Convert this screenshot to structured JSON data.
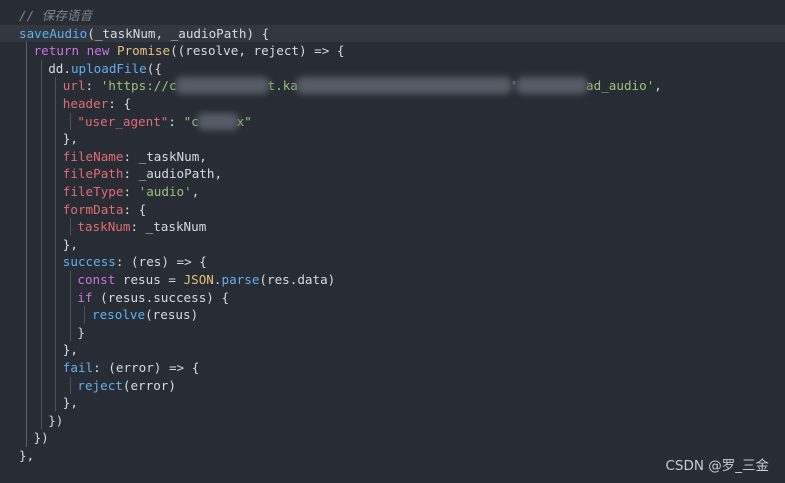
{
  "colors": {
    "background": "#282c34",
    "active_line": "#33373f",
    "comment": "#7f848e",
    "keyword": "#c678dd",
    "function": "#61afef",
    "class": "#e5c07b",
    "property": "#e06c75",
    "string": "#98c379",
    "text": "#d7dae0"
  },
  "editor": {
    "lines": [
      {
        "indent": 0,
        "active": false,
        "tokens": [
          {
            "t": "// 保存语音",
            "c": "comment"
          }
        ]
      },
      {
        "indent": 0,
        "active": true,
        "tokens": [
          {
            "t": "saveAudio",
            "c": "function"
          },
          {
            "t": "(_taskNum, _audioPath) {",
            "c": "text"
          }
        ]
      },
      {
        "indent": 1,
        "active": false,
        "tokens": [
          {
            "t": "return ",
            "c": "keyword"
          },
          {
            "t": "new ",
            "c": "keyword"
          },
          {
            "t": "Promise",
            "c": "class"
          },
          {
            "t": "((resolve, reject) => {",
            "c": "text"
          }
        ]
      },
      {
        "indent": 2,
        "active": false,
        "tokens": [
          {
            "t": "dd.",
            "c": "text"
          },
          {
            "t": "uploadFile",
            "c": "function"
          },
          {
            "t": "({",
            "c": "text"
          }
        ]
      },
      {
        "indent": 3,
        "active": false,
        "tokens": [
          {
            "t": "url",
            "c": "property"
          },
          {
            "t": ": ",
            "c": "text"
          },
          {
            "t": "'https://c",
            "c": "string"
          },
          {
            "t": "            ",
            "c": "text",
            "blur": true
          },
          {
            "t": "t.ka",
            "c": "string"
          },
          {
            "t": "                            ",
            "c": "text",
            "blur": true
          },
          {
            "t": "'",
            "c": "string"
          },
          {
            "t": "         ",
            "c": "text",
            "blur": true
          },
          {
            "t": "ad_audio'",
            "c": "string"
          },
          {
            "t": ",",
            "c": "text"
          }
        ]
      },
      {
        "indent": 3,
        "active": false,
        "tokens": [
          {
            "t": "header",
            "c": "property"
          },
          {
            "t": ": {",
            "c": "text"
          }
        ]
      },
      {
        "indent": 4,
        "active": false,
        "tokens": [
          {
            "t": "\"user_agent\"",
            "c": "property"
          },
          {
            "t": ": ",
            "c": "text"
          },
          {
            "t": "\"c",
            "c": "string"
          },
          {
            "t": "     ",
            "c": "text",
            "blur": true
          },
          {
            "t": "x\"",
            "c": "string"
          }
        ]
      },
      {
        "indent": 3,
        "active": false,
        "tokens": [
          {
            "t": "},",
            "c": "text"
          }
        ]
      },
      {
        "indent": 3,
        "active": false,
        "tokens": [
          {
            "t": "fileName",
            "c": "property"
          },
          {
            "t": ": _taskNum,",
            "c": "text"
          }
        ]
      },
      {
        "indent": 3,
        "active": false,
        "tokens": [
          {
            "t": "filePath",
            "c": "property"
          },
          {
            "t": ": _audioPath,",
            "c": "text"
          }
        ]
      },
      {
        "indent": 3,
        "active": false,
        "tokens": [
          {
            "t": "fileType",
            "c": "property"
          },
          {
            "t": ": ",
            "c": "text"
          },
          {
            "t": "'audio'",
            "c": "string"
          },
          {
            "t": ",",
            "c": "text"
          }
        ]
      },
      {
        "indent": 3,
        "active": false,
        "tokens": [
          {
            "t": "formData",
            "c": "property"
          },
          {
            "t": ": {",
            "c": "text"
          }
        ]
      },
      {
        "indent": 4,
        "active": false,
        "tokens": [
          {
            "t": "taskNum",
            "c": "property"
          },
          {
            "t": ": _taskNum",
            "c": "text"
          }
        ]
      },
      {
        "indent": 3,
        "active": false,
        "tokens": [
          {
            "t": "},",
            "c": "text"
          }
        ]
      },
      {
        "indent": 3,
        "active": false,
        "tokens": [
          {
            "t": "success",
            "c": "function"
          },
          {
            "t": ": (res) => {",
            "c": "text"
          }
        ]
      },
      {
        "indent": 4,
        "active": false,
        "tokens": [
          {
            "t": "const ",
            "c": "keyword"
          },
          {
            "t": "resus = ",
            "c": "text"
          },
          {
            "t": "JSON",
            "c": "class"
          },
          {
            "t": ".",
            "c": "text"
          },
          {
            "t": "parse",
            "c": "function"
          },
          {
            "t": "(res.data)",
            "c": "text"
          }
        ]
      },
      {
        "indent": 4,
        "active": false,
        "tokens": [
          {
            "t": "if ",
            "c": "keyword"
          },
          {
            "t": "(resus.success) {",
            "c": "text"
          }
        ]
      },
      {
        "indent": 5,
        "active": false,
        "tokens": [
          {
            "t": "resolve",
            "c": "function"
          },
          {
            "t": "(resus)",
            "c": "text"
          }
        ]
      },
      {
        "indent": 4,
        "active": false,
        "tokens": [
          {
            "t": "}",
            "c": "text"
          }
        ]
      },
      {
        "indent": 3,
        "active": false,
        "tokens": [
          {
            "t": "},",
            "c": "text"
          }
        ]
      },
      {
        "indent": 3,
        "active": false,
        "tokens": [
          {
            "t": "fail",
            "c": "function"
          },
          {
            "t": ": (error) => {",
            "c": "text"
          }
        ]
      },
      {
        "indent": 4,
        "active": false,
        "tokens": [
          {
            "t": "reject",
            "c": "function"
          },
          {
            "t": "(error)",
            "c": "text"
          }
        ]
      },
      {
        "indent": 3,
        "active": false,
        "tokens": [
          {
            "t": "},",
            "c": "text"
          }
        ]
      },
      {
        "indent": 2,
        "active": false,
        "tokens": [
          {
            "t": "})",
            "c": "text"
          }
        ]
      },
      {
        "indent": 1,
        "active": false,
        "tokens": [
          {
            "t": "})",
            "c": "text"
          }
        ]
      },
      {
        "indent": 0,
        "active": false,
        "tokens": [
          {
            "t": "},",
            "c": "text"
          }
        ]
      }
    ]
  },
  "watermark": "CSDN @罗_三金"
}
